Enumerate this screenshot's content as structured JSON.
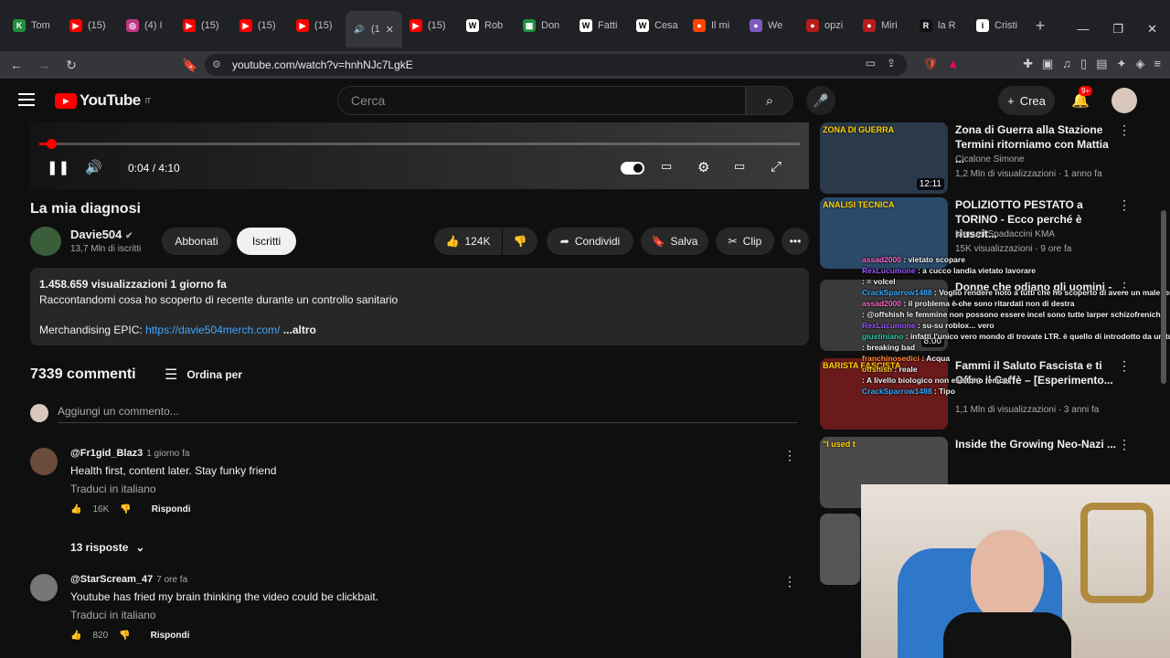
{
  "tabs": [
    {
      "label": "Tom",
      "fav": "K",
      "color": "#1e8e3e"
    },
    {
      "label": "(15)",
      "fav": "▶",
      "color": "#ff0000"
    },
    {
      "label": "(4) I",
      "fav": "◎",
      "color": "#c13584"
    },
    {
      "label": "(15)",
      "fav": "▶",
      "color": "#ff0000"
    },
    {
      "label": "(15)",
      "fav": "▶",
      "color": "#ff0000"
    },
    {
      "label": "(15)",
      "fav": "▶",
      "color": "#ff0000"
    },
    {
      "label": "(1",
      "fav": "🔊",
      "color": "#35363a"
    },
    {
      "label": "(15)",
      "fav": "▶",
      "color": "#ff0000"
    },
    {
      "label": "Rob",
      "fav": "W",
      "color": "#ffffff"
    },
    {
      "label": "Don",
      "fav": "▦",
      "color": "#1e8e3e"
    },
    {
      "label": "Fatti",
      "fav": "W",
      "color": "#ffffff"
    },
    {
      "label": "Cesa",
      "fav": "W",
      "color": "#ffffff"
    },
    {
      "label": "Il mi",
      "fav": "●",
      "color": "#ff4500"
    },
    {
      "label": "We",
      "fav": "●",
      "color": "#7e57c2"
    },
    {
      "label": "opzi",
      "fav": "●",
      "color": "#b71c1c"
    },
    {
      "label": "Miri",
      "fav": "●",
      "color": "#b71c1c"
    },
    {
      "label": "la R",
      "fav": "R",
      "color": "#111111"
    },
    {
      "label": "Cristi",
      "fav": "i",
      "color": "#ffffff"
    }
  ],
  "address": {
    "url": "youtube.com/watch?v=hnhNJc7LgkE"
  },
  "yt": {
    "logo": "YouTube",
    "region": "IT",
    "search_placeholder": "Cerca",
    "create": "Crea",
    "notif_badge": "9+"
  },
  "player": {
    "time": "0:04 / 4:10",
    "progress": 0.016
  },
  "video": {
    "title": "La mia diagnosi",
    "channel": "Davie504",
    "subs": "13,7 Mln di iscritti",
    "join": "Abbonati",
    "subscribed": "Iscritti",
    "likes": "124K",
    "share": "Condividi",
    "save": "Salva",
    "clip": "Clip"
  },
  "description": {
    "meta": "1.458.659 visualizzazioni  1 giorno fa",
    "line1": "Raccontandomi cosa ho scoperto di recente durante un controllo sanitario",
    "merch_label": "Merchandising EPIC: ",
    "merch_link": "https://davie504merch.com/",
    "more": "...altro"
  },
  "comments_header": {
    "count": "7339 commenti",
    "sort": "Ordina per",
    "add_placeholder": "Aggiungi un commento..."
  },
  "comments": [
    {
      "user": "@Fr1gid_Blaz3",
      "when": "1 giorno fa",
      "text": "Health first, content later. Stay funky friend",
      "translate": "Traduci in italiano",
      "likes": "16K",
      "reply": "Rispondi"
    },
    {
      "user": "@StarScream_47",
      "when": "7 ore fa",
      "text": "Youtube has fried my brain thinking the video could be clickbait.",
      "translate": "Traduci in italiano",
      "likes": "820",
      "reply": "Rispondi"
    }
  ],
  "replies_toggle": "13 risposte",
  "sidebar": [
    {
      "title": "Zona di Guerra alla Stazione Termini ritorniamo con Mattia ...",
      "channel": "Cicalone Simone",
      "meta": "1,2 Mln di visualizzazioni · 1 anno fa",
      "duration": "12:11",
      "thumb_text": "ZONA DI GUERRA",
      "thumb_color": "#2b3a4a"
    },
    {
      "title": "POLIZIOTTO PESTATO a TORINO - Ecco perché è riuscit...",
      "channel": "Manuel Spadaccini KMA",
      "meta": "15K visualizzazioni · 9 ore fa",
      "duration": "",
      "thumb_text": "ANALISI TECNICA",
      "thumb_color": "#2a4a6a"
    },
    {
      "title": "Donne che odiano gli uomini - ...",
      "channel": "",
      "meta": "",
      "duration": "8:00",
      "thumb_text": "",
      "thumb_color": "#3a3a3a"
    },
    {
      "title": "Fammi il Saluto Fascista e ti Offro il Caffè – [Esperimento...",
      "channel": "",
      "meta": "1,1 Mln di visualizzazioni · 3 anni fa",
      "duration": "",
      "thumb_text": "BARISTA FASCISTA",
      "thumb_color": "#6a1a1a"
    },
    {
      "title": "Inside the Growing Neo-Nazi ...",
      "channel": "",
      "meta": "",
      "duration": "",
      "thumb_text": "\"I used t",
      "thumb_color": "#4a4a4a"
    }
  ],
  "chat": [
    {
      "user": "assad2000",
      "msg": "vietato scopare",
      "color": "#ff66cc"
    },
    {
      "user": "RexLucumone",
      "msg": "a cucco landia vietato lavorare",
      "color": "#9b59ff"
    },
    {
      "user": "",
      "msg": "= volcel",
      "color": "#ff4444"
    },
    {
      "user": "CrackSparrow1488",
      "msg": "Voglio rendere noto a tutti che ho scoperto di avere un male terminale trompere armato nella redazione di Pizza Party",
      "color": "#33aaff"
    },
    {
      "user": "assad2000",
      "msg": "il problema è che sono ritardati non di destra",
      "color": "#ff66cc"
    },
    {
      "user": "",
      "msg": "@offshish le femmine non possono essere incel sono tutte larper schizofreniche",
      "color": "#ff4444"
    },
    {
      "user": "RexLucumone",
      "msg": "su-su roblox... vero",
      "color": "#9b59ff"
    },
    {
      "user": "giustiniano",
      "msg": "infatti l'unico vero mondo di trovate LTR. è quello di introdotto da un tuo amico quindi solo amiche di amici, solo che sta roba riduce un botto il cerchio",
      "color": "#33ccaa"
    },
    {
      "user": "",
      "msg": "breaking bad",
      "color": "#ff4444"
    },
    {
      "user": "franchinosedici",
      "msg": "Acqua",
      "color": "#ff8833"
    },
    {
      "user": "offshish",
      "msg": "reale",
      "color": "#ffcc33"
    },
    {
      "user": "",
      "msg": "A livello biologico non esistono femcel",
      "color": "#ff4444"
    },
    {
      "user": "CrackSparrow1488",
      "msg": "Tipo",
      "color": "#33aaff"
    }
  ]
}
